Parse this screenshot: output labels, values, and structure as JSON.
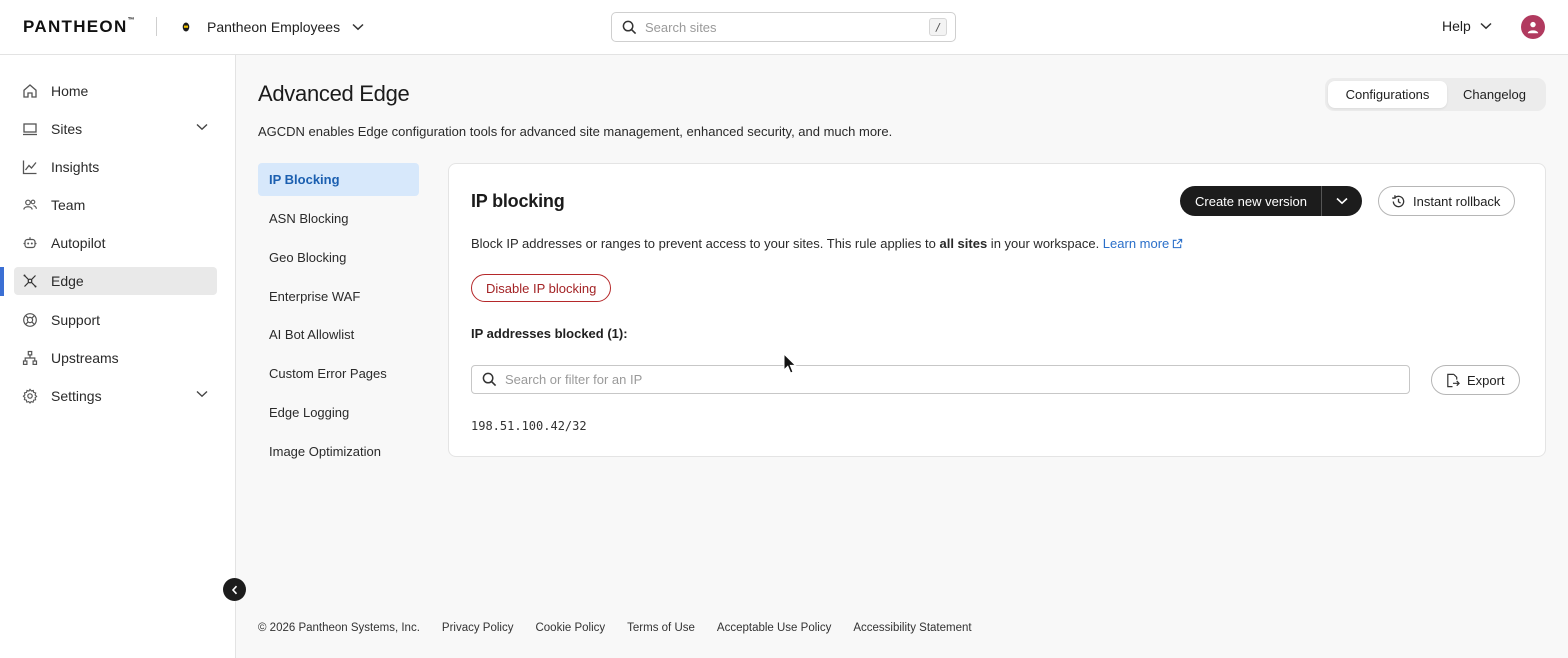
{
  "topbar": {
    "logo": "PANTHEON",
    "logo_mark": "™",
    "workspace": "Pantheon Employees",
    "search_placeholder": "Search sites",
    "search_shortcut": "/",
    "help_label": "Help"
  },
  "sidebar": {
    "items": [
      {
        "label": "Home",
        "icon": "home-icon"
      },
      {
        "label": "Sites",
        "icon": "sites-icon",
        "expandable": true
      },
      {
        "label": "Insights",
        "icon": "insights-icon"
      },
      {
        "label": "Team",
        "icon": "team-icon"
      },
      {
        "label": "Autopilot",
        "icon": "autopilot-icon"
      },
      {
        "label": "Edge",
        "icon": "edge-icon",
        "active": true
      },
      {
        "label": "Support",
        "icon": "support-icon"
      },
      {
        "label": "Upstreams",
        "icon": "upstreams-icon"
      },
      {
        "label": "Settings",
        "icon": "settings-icon",
        "expandable": true
      }
    ]
  },
  "main": {
    "title": "Advanced Edge",
    "description": "AGCDN enables Edge configuration tools for advanced site management, enhanced security, and much more.",
    "tabs": [
      {
        "label": "Configurations",
        "selected": true
      },
      {
        "label": "Changelog",
        "selected": false
      }
    ],
    "subnav": [
      {
        "label": "IP Blocking",
        "active": true
      },
      {
        "label": "ASN Blocking"
      },
      {
        "label": "Geo Blocking"
      },
      {
        "label": "Enterprise WAF"
      },
      {
        "label": "AI Bot Allowlist"
      },
      {
        "label": "Custom Error Pages"
      },
      {
        "label": "Edge Logging"
      },
      {
        "label": "Image Optimization"
      }
    ]
  },
  "panel": {
    "title": "IP blocking",
    "create_version_label": "Create new version",
    "rollback_label": "Instant rollback",
    "desc_before": "Block IP addresses or ranges to prevent access to your sites. This rule applies to ",
    "desc_bold": "all sites",
    "desc_after": " in your workspace. ",
    "learn_more": "Learn more",
    "disable_label": "Disable IP blocking",
    "blocked_label": "IP addresses blocked (1):",
    "filter_placeholder": "Search or filter for an IP",
    "export_label": "Export",
    "ips": [
      "198.51.100.42/32"
    ]
  },
  "footer": {
    "copyright": "© 2026 Pantheon Systems, Inc.",
    "links": [
      "Privacy Policy",
      "Cookie Policy",
      "Terms of Use",
      "Acceptable Use Policy",
      "Accessibility Statement"
    ]
  },
  "colors": {
    "accent_blue": "#2a6fc9",
    "active_subnav_bg": "#d7e8fb",
    "danger": "#a32325",
    "avatar": "#b13a5f",
    "dark_button": "#1c1c1c"
  }
}
